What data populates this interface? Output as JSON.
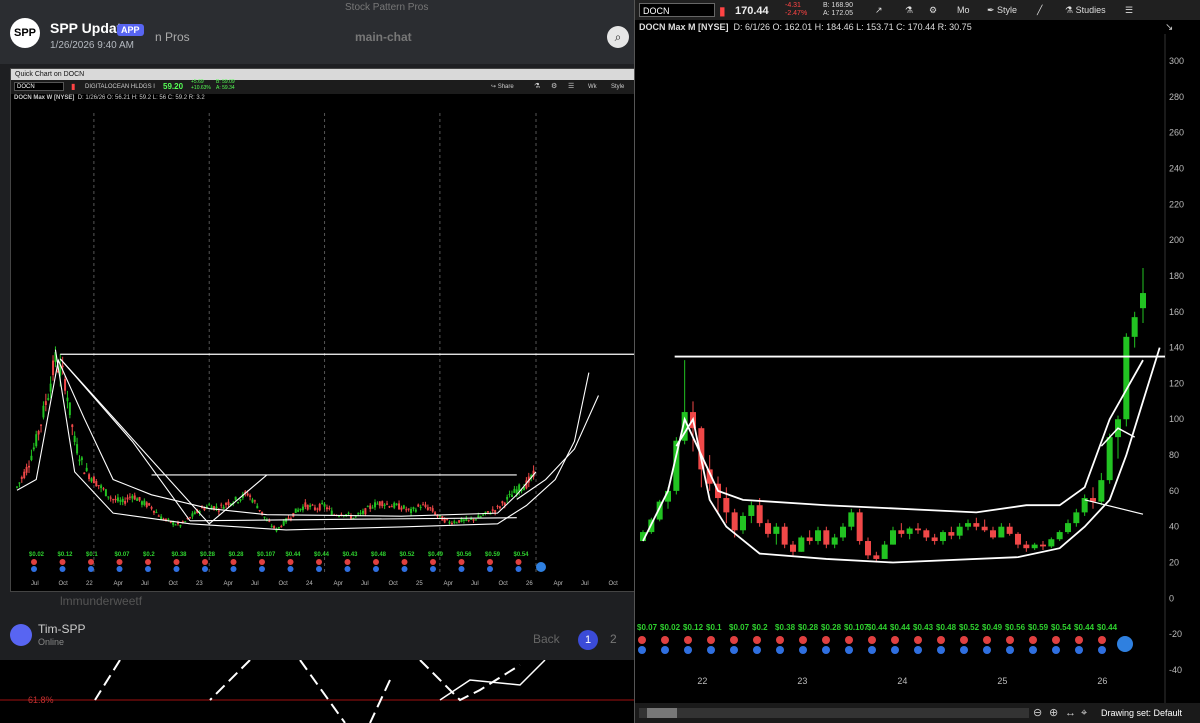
{
  "notification": {
    "app_icon_text": "SPP",
    "app_name": "SPP Update",
    "badge": "APP",
    "date": "1/26/2026 9:40 AM",
    "zoom_icon": "search-icon"
  },
  "background": {
    "window_title": "Stock Pattern Pros",
    "server_name": "n Pros",
    "channel": "main-chat",
    "channel2": "lmmunderweetf",
    "user": "Tim-SPP",
    "user_status": "Online",
    "back_label": "Back",
    "page1": "1",
    "page2": "2",
    "fib_label": "61.8%"
  },
  "left_chart": {
    "window_title": "Quick Chart on DOCN",
    "symbol": "DOCN",
    "company": "DIGITALOCEAN HLDGS I",
    "price": "59.20",
    "change": "+5.69",
    "change_pct": "+10.63%",
    "bid": "B: 59.09",
    "ask": "A: 59.34",
    "share_label": "Share",
    "timeframe_label": "Wk",
    "style_label": "Style",
    "header": "DOCN Max W [NYSE]",
    "ohlc": "D: 1/26/26   O: 56.21   H: 59.2   L: 56   C: 59.2   R: 3.2",
    "x_labels": [
      "Jul",
      "Oct",
      "22",
      "Apr",
      "Jul",
      "Oct",
      "23",
      "Apr",
      "Jul",
      "Oct",
      "24",
      "Apr",
      "Jul",
      "Oct",
      "25",
      "Apr",
      "Jul",
      "Oct",
      "26",
      "Apr",
      "Jul",
      "Oct"
    ],
    "dividends": [
      "$0.02",
      "$0.12",
      "$0.1",
      "$0.07",
      "$0.2",
      "$0.38",
      "$0.28",
      "$0.28",
      "$0.107",
      "$0.44",
      "$0.44",
      "$0.43",
      "$0.48",
      "$0.52",
      "$0.49",
      "$0.56",
      "$0.59",
      "$0.54"
    ]
  },
  "right_chart": {
    "symbol": "DOCN",
    "price": "170.44",
    "change": "-4.31",
    "change_pct": "-2.47%",
    "bid": "B: 168.90",
    "ask": "A: 172.05",
    "period_label": "Mo",
    "style_label": "Style",
    "studies_label": "Studies",
    "header": "DOCN Max M [NYSE]",
    "ohlc": "D: 6/1/26   O: 162.01   H: 184.46   L: 153.71   C: 170.44   R: 30.75",
    "drawing_set": "Drawing set: Default",
    "dividends": [
      "$0.07",
      "$0.02",
      "$0.12",
      "$0.1",
      "$0.07",
      "$0.2",
      "$0.38",
      "$0.28",
      "$0.28",
      "$0.107",
      "$0.44",
      "$0.44",
      "$0.43",
      "$0.48",
      "$0.52",
      "$0.49",
      "$0.56",
      "$0.59",
      "$0.54",
      "$0.44",
      "$0.44"
    ]
  },
  "chart_data": [
    {
      "type": "candlestick",
      "title": "DOCN Max W [NYSE]",
      "ylim": [
        20,
        200
      ],
      "x_labels": [
        "Jul",
        "Oct",
        "22",
        "Apr",
        "Jul",
        "Oct",
        "23",
        "Apr",
        "Jul",
        "Oct",
        "24",
        "Apr",
        "Jul",
        "Oct",
        "25",
        "Apr",
        "Jul",
        "Oct",
        "26"
      ],
      "close_path": [
        {
          "x": "Jul 21",
          "y": 50
        },
        {
          "x": "Aug 21",
          "y": 62
        },
        {
          "x": "Sep 21",
          "y": 80
        },
        {
          "x": "Oct 21",
          "y": 105
        },
        {
          "x": "Nov 21",
          "y": 133
        },
        {
          "x": "Dec 21",
          "y": 120
        },
        {
          "x": "Jan 22",
          "y": 80
        },
        {
          "x": "Feb 22",
          "y": 62
        },
        {
          "x": "Mar 22",
          "y": 55
        },
        {
          "x": "Apr 22",
          "y": 48
        },
        {
          "x": "May 22",
          "y": 42
        },
        {
          "x": "Jun 22",
          "y": 40
        },
        {
          "x": "Jul 22",
          "y": 45
        },
        {
          "x": "Aug 22",
          "y": 40
        },
        {
          "x": "Sep 22",
          "y": 37
        },
        {
          "x": "Oct 22",
          "y": 30
        },
        {
          "x": "Nov 22",
          "y": 27
        },
        {
          "x": "Dec 22",
          "y": 25
        },
        {
          "x": "Jan 23",
          "y": 30
        },
        {
          "x": "Feb 23",
          "y": 35
        },
        {
          "x": "Mar 23",
          "y": 38
        },
        {
          "x": "Apr 23",
          "y": 36
        },
        {
          "x": "May 23",
          "y": 40
        },
        {
          "x": "Jun 23",
          "y": 42
        },
        {
          "x": "Jul 23",
          "y": 46
        },
        {
          "x": "Aug 23",
          "y": 38
        },
        {
          "x": "Sep 23",
          "y": 28
        },
        {
          "x": "Oct 23",
          "y": 22
        },
        {
          "x": "Nov 23",
          "y": 28
        },
        {
          "x": "Dec 23",
          "y": 34
        },
        {
          "x": "Jan 24",
          "y": 38
        },
        {
          "x": "Feb 24",
          "y": 36
        },
        {
          "x": "Mar 24",
          "y": 38
        },
        {
          "x": "Apr 24",
          "y": 32
        },
        {
          "x": "May 24",
          "y": 33
        },
        {
          "x": "Jun 24",
          "y": 30
        },
        {
          "x": "Jul 24",
          "y": 33
        },
        {
          "x": "Aug 24",
          "y": 38
        },
        {
          "x": "Sep 24",
          "y": 40
        },
        {
          "x": "Oct 24",
          "y": 38
        },
        {
          "x": "Nov 24",
          "y": 37
        },
        {
          "x": "Dec 24",
          "y": 34
        },
        {
          "x": "Jan 25",
          "y": 38
        },
        {
          "x": "Feb 25",
          "y": 36
        },
        {
          "x": "Mar 25",
          "y": 30
        },
        {
          "x": "Apr 25",
          "y": 27
        },
        {
          "x": "May 25",
          "y": 28
        },
        {
          "x": "Jun 25",
          "y": 28
        },
        {
          "x": "Jul 25",
          "y": 30
        },
        {
          "x": "Aug 25",
          "y": 33
        },
        {
          "x": "Sep 25",
          "y": 36
        },
        {
          "x": "Oct 25",
          "y": 42
        },
        {
          "x": "Nov 25",
          "y": 48
        },
        {
          "x": "Dec 25",
          "y": 52
        },
        {
          "x": "Jan 26",
          "y": 59.2
        }
      ]
    },
    {
      "type": "candlestick",
      "title": "DOCN Max M [NYSE]",
      "ylim": [
        -40,
        310
      ],
      "y_ticks": [
        -40,
        -20,
        0,
        20,
        40,
        60,
        80,
        100,
        120,
        140,
        160,
        180,
        200,
        220,
        240,
        260,
        280,
        300
      ],
      "x_labels": [
        "22",
        "23",
        "24",
        "25",
        "26"
      ],
      "candles": [
        {
          "t": "Jun 21",
          "o": 32,
          "h": 38,
          "l": 32,
          "c": 37
        },
        {
          "t": "Jul 21",
          "o": 37,
          "h": 45,
          "l": 36,
          "c": 44
        },
        {
          "t": "Aug 21",
          "o": 44,
          "h": 55,
          "l": 43,
          "c": 54
        },
        {
          "t": "Sep 21",
          "o": 54,
          "h": 62,
          "l": 50,
          "c": 60
        },
        {
          "t": "Oct 21",
          "o": 60,
          "h": 90,
          "l": 58,
          "c": 88
        },
        {
          "t": "Nov 21",
          "o": 88,
          "h": 133,
          "l": 86,
          "c": 104
        },
        {
          "t": "Dec 21",
          "o": 104,
          "h": 110,
          "l": 82,
          "c": 95
        },
        {
          "t": "Jan 22",
          "o": 95,
          "h": 96,
          "l": 62,
          "c": 72
        },
        {
          "t": "Feb 22",
          "o": 72,
          "h": 80,
          "l": 60,
          "c": 64
        },
        {
          "t": "Mar 22",
          "o": 64,
          "h": 68,
          "l": 48,
          "c": 56
        },
        {
          "t": "Apr 22",
          "o": 56,
          "h": 62,
          "l": 42,
          "c": 48
        },
        {
          "t": "May 22",
          "o": 48,
          "h": 50,
          "l": 34,
          "c": 38
        },
        {
          "t": "Jun 22",
          "o": 38,
          "h": 48,
          "l": 36,
          "c": 46
        },
        {
          "t": "Jul 22",
          "o": 46,
          "h": 54,
          "l": 42,
          "c": 52
        },
        {
          "t": "Aug 22",
          "o": 52,
          "h": 56,
          "l": 40,
          "c": 42
        },
        {
          "t": "Sep 22",
          "o": 42,
          "h": 44,
          "l": 34,
          "c": 36
        },
        {
          "t": "Oct 22",
          "o": 36,
          "h": 42,
          "l": 30,
          "c": 40
        },
        {
          "t": "Nov 22",
          "o": 40,
          "h": 42,
          "l": 28,
          "c": 30
        },
        {
          "t": "Dec 22",
          "o": 30,
          "h": 32,
          "l": 24,
          "c": 26
        },
        {
          "t": "Jan 23",
          "o": 26,
          "h": 35,
          "l": 26,
          "c": 34
        },
        {
          "t": "Feb 23",
          "o": 34,
          "h": 38,
          "l": 30,
          "c": 32
        },
        {
          "t": "Mar 23",
          "o": 32,
          "h": 40,
          "l": 30,
          "c": 38
        },
        {
          "t": "Apr 23",
          "o": 38,
          "h": 40,
          "l": 28,
          "c": 30
        },
        {
          "t": "May 23",
          "o": 30,
          "h": 36,
          "l": 28,
          "c": 34
        },
        {
          "t": "Jun 23",
          "o": 34,
          "h": 42,
          "l": 32,
          "c": 40
        },
        {
          "t": "Jul 23",
          "o": 40,
          "h": 50,
          "l": 38,
          "c": 48
        },
        {
          "t": "Aug 23",
          "o": 48,
          "h": 50,
          "l": 30,
          "c": 32
        },
        {
          "t": "Sep 23",
          "o": 32,
          "h": 34,
          "l": 22,
          "c": 24
        },
        {
          "t": "Oct 23",
          "o": 24,
          "h": 26,
          "l": 20,
          "c": 22
        },
        {
          "t": "Nov 23",
          "o": 22,
          "h": 32,
          "l": 22,
          "c": 30
        },
        {
          "t": "Dec 23",
          "o": 30,
          "h": 40,
          "l": 30,
          "c": 38
        },
        {
          "t": "Jan 24",
          "o": 38,
          "h": 42,
          "l": 34,
          "c": 36
        },
        {
          "t": "Feb 24",
          "o": 36,
          "h": 40,
          "l": 33,
          "c": 39
        },
        {
          "t": "Mar 24",
          "o": 39,
          "h": 42,
          "l": 36,
          "c": 38
        },
        {
          "t": "Apr 24",
          "o": 38,
          "h": 39,
          "l": 32,
          "c": 34
        },
        {
          "t": "May 24",
          "o": 34,
          "h": 36,
          "l": 30,
          "c": 32
        },
        {
          "t": "Jun 24",
          "o": 32,
          "h": 38,
          "l": 30,
          "c": 37
        },
        {
          "t": "Jul 24",
          "o": 37,
          "h": 40,
          "l": 33,
          "c": 35
        },
        {
          "t": "Aug 24",
          "o": 35,
          "h": 42,
          "l": 33,
          "c": 40
        },
        {
          "t": "Sep 24",
          "o": 40,
          "h": 44,
          "l": 38,
          "c": 42
        },
        {
          "t": "Oct 24",
          "o": 42,
          "h": 45,
          "l": 38,
          "c": 40
        },
        {
          "t": "Nov 24",
          "o": 40,
          "h": 44,
          "l": 37,
          "c": 38
        },
        {
          "t": "Dec 24",
          "o": 38,
          "h": 40,
          "l": 33,
          "c": 34
        },
        {
          "t": "Jan 25",
          "o": 34,
          "h": 42,
          "l": 34,
          "c": 40
        },
        {
          "t": "Feb 25",
          "o": 40,
          "h": 42,
          "l": 35,
          "c": 36
        },
        {
          "t": "Mar 25",
          "o": 36,
          "h": 37,
          "l": 28,
          "c": 30
        },
        {
          "t": "Apr 25",
          "o": 30,
          "h": 32,
          "l": 26,
          "c": 28
        },
        {
          "t": "May 25",
          "o": 28,
          "h": 31,
          "l": 27,
          "c": 30
        },
        {
          "t": "Jun 25",
          "o": 30,
          "h": 32,
          "l": 27,
          "c": 29
        },
        {
          "t": "Jul 25",
          "o": 29,
          "h": 34,
          "l": 28,
          "c": 33
        },
        {
          "t": "Aug 25",
          "o": 33,
          "h": 38,
          "l": 32,
          "c": 37
        },
        {
          "t": "Sep 25",
          "o": 37,
          "h": 44,
          "l": 36,
          "c": 42
        },
        {
          "t": "Oct 25",
          "o": 42,
          "h": 50,
          "l": 40,
          "c": 48
        },
        {
          "t": "Nov 25",
          "o": 48,
          "h": 58,
          "l": 46,
          "c": 56
        },
        {
          "t": "Dec 25",
          "o": 56,
          "h": 62,
          "l": 50,
          "c": 54
        },
        {
          "t": "Jan 26",
          "o": 54,
          "h": 70,
          "l": 52,
          "c": 66
        },
        {
          "t": "Feb 26",
          "o": 66,
          "h": 92,
          "l": 64,
          "c": 90
        },
        {
          "t": "Mar 26",
          "o": 90,
          "h": 102,
          "l": 78,
          "c": 100
        },
        {
          "t": "Apr 26",
          "o": 100,
          "h": 148,
          "l": 96,
          "c": 146
        },
        {
          "t": "May 26",
          "o": 146,
          "h": 160,
          "l": 140,
          "c": 157
        },
        {
          "t": "Jun 26",
          "o": 162.01,
          "h": 184.46,
          "l": 153.71,
          "c": 170.44
        }
      ],
      "breakout_line": 135
    }
  ]
}
